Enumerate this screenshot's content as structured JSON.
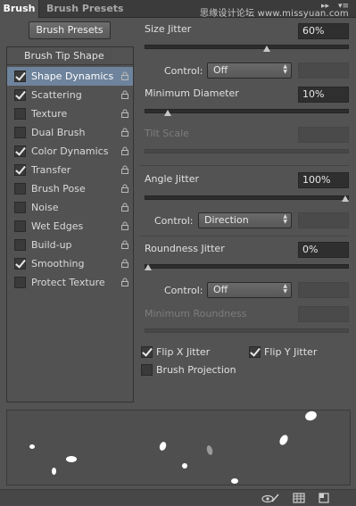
{
  "tabs": {
    "active": "Brush",
    "inactive": "Brush Presets",
    "collapse_glyph": "▸▸",
    "menu_glyph": "▾≡"
  },
  "watermark": "思缘设计论坛 www.missyuan.com",
  "presets_button": "Brush Presets",
  "brush_tip_shape": "Brush Tip Shape",
  "options": [
    {
      "label": "Shape Dynamics",
      "checked": true,
      "selected": true
    },
    {
      "label": "Scattering",
      "checked": true,
      "selected": false
    },
    {
      "label": "Texture",
      "checked": false,
      "selected": false
    },
    {
      "label": "Dual Brush",
      "checked": false,
      "selected": false
    },
    {
      "label": "Color Dynamics",
      "checked": true,
      "selected": false
    },
    {
      "label": "Transfer",
      "checked": true,
      "selected": false
    },
    {
      "label": "Brush Pose",
      "checked": false,
      "selected": false
    },
    {
      "label": "Noise",
      "checked": false,
      "selected": false
    },
    {
      "label": "Wet Edges",
      "checked": false,
      "selected": false
    },
    {
      "label": "Build-up",
      "checked": false,
      "selected": false
    },
    {
      "label": "Smoothing",
      "checked": true,
      "selected": false
    },
    {
      "label": "Protect Texture",
      "checked": false,
      "selected": false
    }
  ],
  "size_jitter": {
    "label": "Size Jitter",
    "value": "60%",
    "level": 0.6
  },
  "size_control": {
    "label": "Control:",
    "value": "Off"
  },
  "minimum_diameter": {
    "label": "Minimum Diameter",
    "value": "10%",
    "level": 0.1
  },
  "tilt_scale": {
    "label": "Tilt Scale"
  },
  "angle_jitter": {
    "label": "Angle Jitter",
    "value": "100%",
    "level": 1.0
  },
  "angle_control": {
    "label": "Control:",
    "value": "Direction"
  },
  "roundness_jitter": {
    "label": "Roundness Jitter",
    "value": "0%",
    "level": 0.0
  },
  "roundness_control": {
    "label": "Control:",
    "value": "Off"
  },
  "minimum_roundness": {
    "label": "Minimum Roundness"
  },
  "flip_x": {
    "label": "Flip X Jitter",
    "checked": true
  },
  "flip_y": {
    "label": "Flip Y Jitter",
    "checked": true
  },
  "brush_projection": {
    "label": "Brush Projection",
    "checked": false
  },
  "colors": {
    "panel": "#535353",
    "selection": "#6e839c",
    "field": "#2f2f2f"
  },
  "icons": {
    "lock": "lock-icon",
    "toggle_preview": "eye-brush-icon",
    "grid": "grid-icon",
    "new_preset": "new-preset-icon"
  }
}
